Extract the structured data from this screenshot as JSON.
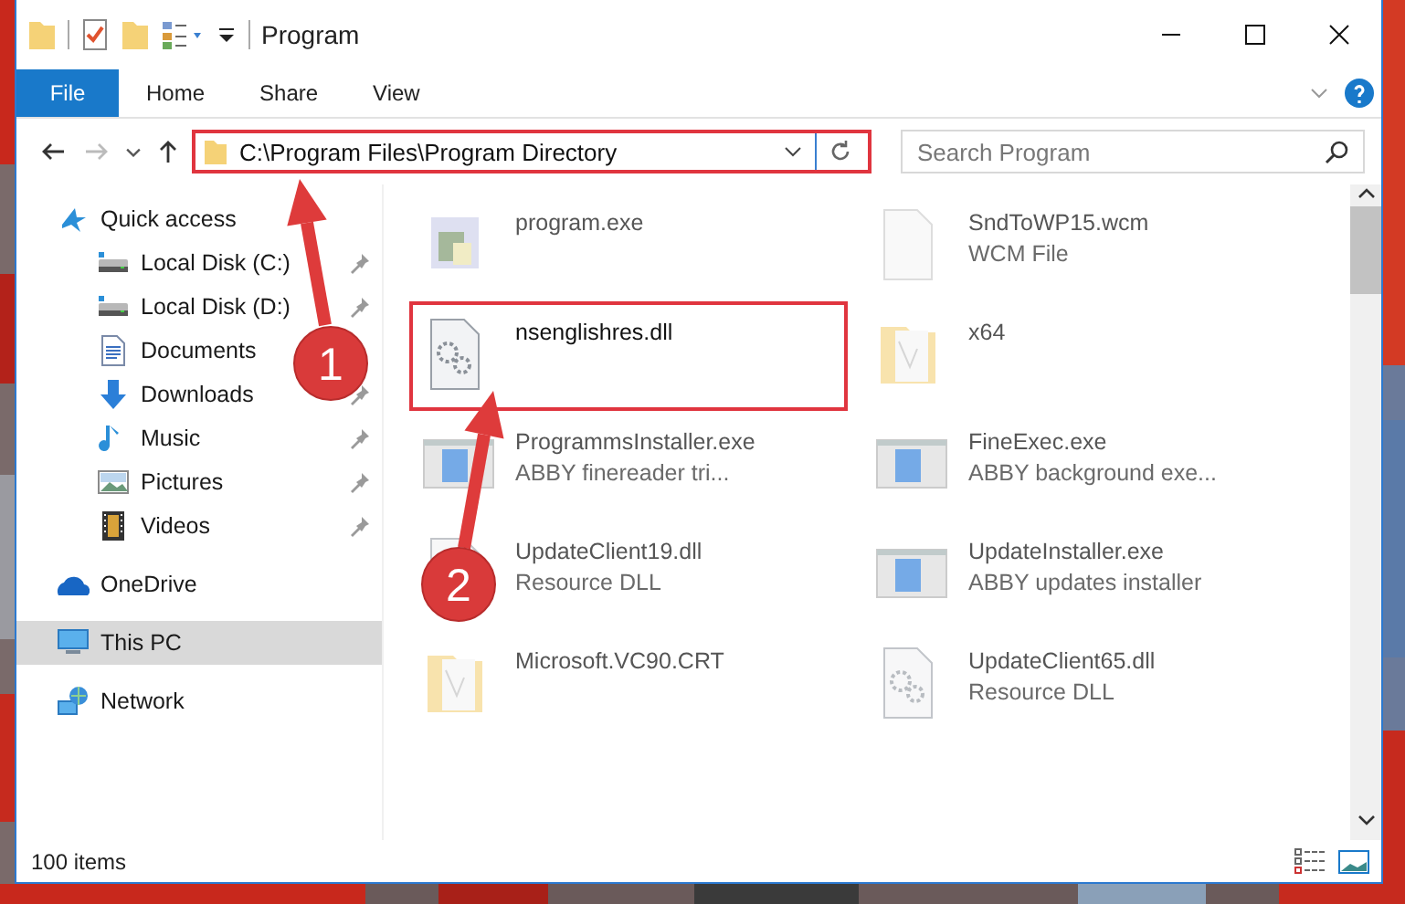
{
  "window": {
    "title": "Program"
  },
  "ribbon": {
    "file_tab": "File",
    "tabs": [
      "Home",
      "Share",
      "View"
    ]
  },
  "address": {
    "path": "C:\\Program Files\\Program Directory",
    "highlighted": true
  },
  "search": {
    "placeholder": "Search Program"
  },
  "sidebar": {
    "items": [
      {
        "label": "Quick access",
        "kind": "star",
        "selected": false,
        "children": [
          {
            "label": "Local Disk (C:)",
            "kind": "drive",
            "selected": false,
            "pinned": true
          },
          {
            "label": "Local Disk (D:)",
            "kind": "drive",
            "selected": false,
            "pinned": true
          },
          {
            "label": "Documents",
            "kind": "doc",
            "selected": false,
            "pinned": false
          },
          {
            "label": "Downloads",
            "kind": "download",
            "selected": false,
            "pinned": true
          },
          {
            "label": "Music",
            "kind": "music",
            "selected": false,
            "pinned": true
          },
          {
            "label": "Pictures",
            "kind": "pictures",
            "selected": false,
            "pinned": true
          },
          {
            "label": "Videos",
            "kind": "videos",
            "selected": false,
            "pinned": true
          }
        ]
      },
      {
        "label": "OneDrive",
        "kind": "cloud",
        "selected": false
      },
      {
        "label": "This PC",
        "kind": "pc",
        "selected": true
      },
      {
        "label": "Network",
        "kind": "network",
        "selected": false
      }
    ]
  },
  "files": [
    {
      "name": "program.exe",
      "kind": "exe",
      "highlighted": false
    },
    {
      "name": "SndToWP15.wcm",
      "type": "WCM File",
      "kind": "file",
      "highlighted": false
    },
    {
      "name": "nsenglishres.dll",
      "kind": "dll",
      "highlighted": true
    },
    {
      "name": "x64",
      "kind": "folder",
      "highlighted": false
    },
    {
      "name": "ProgrammsInstaller.exe",
      "type": "ABBY finereader tri...",
      "kind": "app",
      "highlighted": false
    },
    {
      "name": "FineExec.exe",
      "type": "ABBY background exe...",
      "kind": "app",
      "highlighted": false
    },
    {
      "name": "UpdateClient19.dll",
      "type": "Resource DLL",
      "kind": "dll",
      "highlighted": false
    },
    {
      "name": "UpdateInstaller.exe",
      "type": "ABBY updates installer",
      "kind": "app",
      "highlighted": false
    },
    {
      "name": "Microsoft.VC90.CRT",
      "kind": "folder",
      "highlighted": false
    },
    {
      "name": "UpdateClient65.dll",
      "type": "Resource DLL",
      "kind": "dll",
      "highlighted": false
    }
  ],
  "status_bar": {
    "count": "100 items"
  },
  "annotations": [
    {
      "label": "1"
    },
    {
      "label": "2"
    }
  ]
}
